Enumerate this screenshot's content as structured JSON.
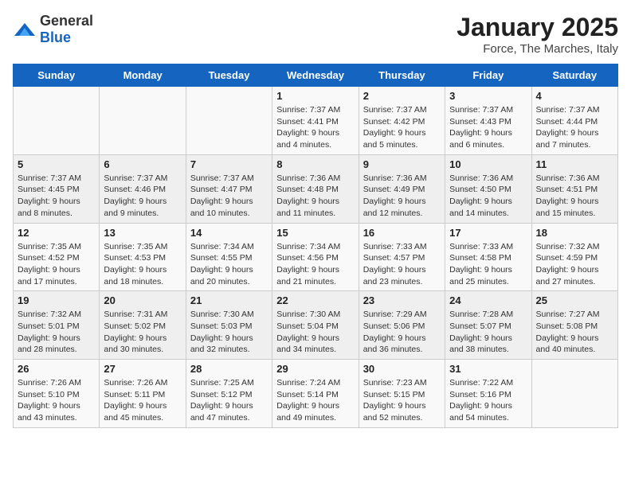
{
  "header": {
    "logo_general": "General",
    "logo_blue": "Blue",
    "month_year": "January 2025",
    "location": "Force, The Marches, Italy"
  },
  "weekdays": [
    "Sunday",
    "Monday",
    "Tuesday",
    "Wednesday",
    "Thursday",
    "Friday",
    "Saturday"
  ],
  "weeks": [
    [
      {
        "day": "",
        "info": ""
      },
      {
        "day": "",
        "info": ""
      },
      {
        "day": "",
        "info": ""
      },
      {
        "day": "1",
        "info": "Sunrise: 7:37 AM\nSunset: 4:41 PM\nDaylight: 9 hours and 4 minutes."
      },
      {
        "day": "2",
        "info": "Sunrise: 7:37 AM\nSunset: 4:42 PM\nDaylight: 9 hours and 5 minutes."
      },
      {
        "day": "3",
        "info": "Sunrise: 7:37 AM\nSunset: 4:43 PM\nDaylight: 9 hours and 6 minutes."
      },
      {
        "day": "4",
        "info": "Sunrise: 7:37 AM\nSunset: 4:44 PM\nDaylight: 9 hours and 7 minutes."
      }
    ],
    [
      {
        "day": "5",
        "info": "Sunrise: 7:37 AM\nSunset: 4:45 PM\nDaylight: 9 hours and 8 minutes."
      },
      {
        "day": "6",
        "info": "Sunrise: 7:37 AM\nSunset: 4:46 PM\nDaylight: 9 hours and 9 minutes."
      },
      {
        "day": "7",
        "info": "Sunrise: 7:37 AM\nSunset: 4:47 PM\nDaylight: 9 hours and 10 minutes."
      },
      {
        "day": "8",
        "info": "Sunrise: 7:36 AM\nSunset: 4:48 PM\nDaylight: 9 hours and 11 minutes."
      },
      {
        "day": "9",
        "info": "Sunrise: 7:36 AM\nSunset: 4:49 PM\nDaylight: 9 hours and 12 minutes."
      },
      {
        "day": "10",
        "info": "Sunrise: 7:36 AM\nSunset: 4:50 PM\nDaylight: 9 hours and 14 minutes."
      },
      {
        "day": "11",
        "info": "Sunrise: 7:36 AM\nSunset: 4:51 PM\nDaylight: 9 hours and 15 minutes."
      }
    ],
    [
      {
        "day": "12",
        "info": "Sunrise: 7:35 AM\nSunset: 4:52 PM\nDaylight: 9 hours and 17 minutes."
      },
      {
        "day": "13",
        "info": "Sunrise: 7:35 AM\nSunset: 4:53 PM\nDaylight: 9 hours and 18 minutes."
      },
      {
        "day": "14",
        "info": "Sunrise: 7:34 AM\nSunset: 4:55 PM\nDaylight: 9 hours and 20 minutes."
      },
      {
        "day": "15",
        "info": "Sunrise: 7:34 AM\nSunset: 4:56 PM\nDaylight: 9 hours and 21 minutes."
      },
      {
        "day": "16",
        "info": "Sunrise: 7:33 AM\nSunset: 4:57 PM\nDaylight: 9 hours and 23 minutes."
      },
      {
        "day": "17",
        "info": "Sunrise: 7:33 AM\nSunset: 4:58 PM\nDaylight: 9 hours and 25 minutes."
      },
      {
        "day": "18",
        "info": "Sunrise: 7:32 AM\nSunset: 4:59 PM\nDaylight: 9 hours and 27 minutes."
      }
    ],
    [
      {
        "day": "19",
        "info": "Sunrise: 7:32 AM\nSunset: 5:01 PM\nDaylight: 9 hours and 28 minutes."
      },
      {
        "day": "20",
        "info": "Sunrise: 7:31 AM\nSunset: 5:02 PM\nDaylight: 9 hours and 30 minutes."
      },
      {
        "day": "21",
        "info": "Sunrise: 7:30 AM\nSunset: 5:03 PM\nDaylight: 9 hours and 32 minutes."
      },
      {
        "day": "22",
        "info": "Sunrise: 7:30 AM\nSunset: 5:04 PM\nDaylight: 9 hours and 34 minutes."
      },
      {
        "day": "23",
        "info": "Sunrise: 7:29 AM\nSunset: 5:06 PM\nDaylight: 9 hours and 36 minutes."
      },
      {
        "day": "24",
        "info": "Sunrise: 7:28 AM\nSunset: 5:07 PM\nDaylight: 9 hours and 38 minutes."
      },
      {
        "day": "25",
        "info": "Sunrise: 7:27 AM\nSunset: 5:08 PM\nDaylight: 9 hours and 40 minutes."
      }
    ],
    [
      {
        "day": "26",
        "info": "Sunrise: 7:26 AM\nSunset: 5:10 PM\nDaylight: 9 hours and 43 minutes."
      },
      {
        "day": "27",
        "info": "Sunrise: 7:26 AM\nSunset: 5:11 PM\nDaylight: 9 hours and 45 minutes."
      },
      {
        "day": "28",
        "info": "Sunrise: 7:25 AM\nSunset: 5:12 PM\nDaylight: 9 hours and 47 minutes."
      },
      {
        "day": "29",
        "info": "Sunrise: 7:24 AM\nSunset: 5:14 PM\nDaylight: 9 hours and 49 minutes."
      },
      {
        "day": "30",
        "info": "Sunrise: 7:23 AM\nSunset: 5:15 PM\nDaylight: 9 hours and 52 minutes."
      },
      {
        "day": "31",
        "info": "Sunrise: 7:22 AM\nSunset: 5:16 PM\nDaylight: 9 hours and 54 minutes."
      },
      {
        "day": "",
        "info": ""
      }
    ]
  ]
}
